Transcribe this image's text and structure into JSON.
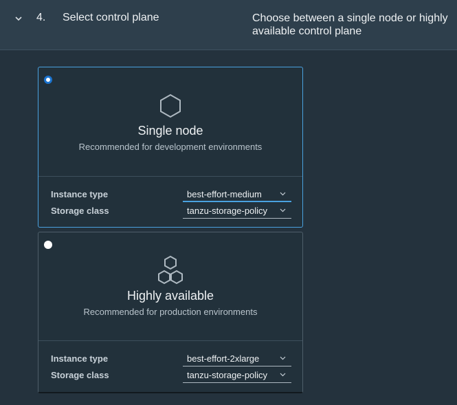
{
  "step": {
    "number": "4.",
    "title": "Select control plane",
    "description": "Choose between a single node or highly available control plane",
    "icon": "chevron-down-icon"
  },
  "options": [
    {
      "title": "Single node",
      "subtitle": "Recommended for development environments",
      "icon": "hexagon-icon",
      "selected": true,
      "instance_type_label": "Instance type",
      "instance_type_value": "best-effort-medium",
      "storage_class_label": "Storage class",
      "storage_class_value": "tanzu-storage-policy"
    },
    {
      "title": "Highly available",
      "subtitle": "Recommended for production environments",
      "icon": "triple-hexagon-icon",
      "selected": false,
      "instance_type_label": "Instance type",
      "instance_type_value": "best-effort-2xlarge",
      "storage_class_label": "Storage class",
      "storage_class_value": "tanzu-storage-policy"
    }
  ],
  "colors": {
    "accent": "#4aa2e0",
    "radio_selected": "#1b74d0",
    "header_bg": "#2e3f4c",
    "body_bg": "#24323d"
  }
}
